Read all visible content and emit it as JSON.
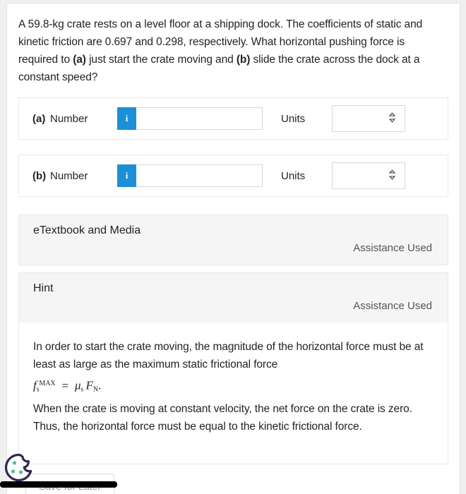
{
  "question": {
    "text_parts": [
      {
        "t": "A 59.8-kg crate rests on a level floor at a shipping dock. The coefficients of static and kinetic friction are 0.697 and 0.298, respectively. What horizontal pushing force is required to ",
        "b": false
      },
      {
        "t": "(a)",
        "b": true
      },
      {
        "t": " just start the crate moving and ",
        "b": false
      },
      {
        "t": "(b)",
        "b": true
      },
      {
        "t": " slide the crate across the dock at a constant speed?",
        "b": false
      }
    ],
    "full_text": "A 59.8-kg crate rests on a level floor at a shipping dock. The coefficients of static and kinetic friction are 0.697 and 0.298, respectively. What horizontal pushing force is required to (a) just start the crate moving and (b) slide the crate across the dock at a constant speed?",
    "mass": "59.8-kg",
    "mu_static": "0.697",
    "mu_kinetic": "0.298"
  },
  "answers": [
    {
      "part": "(a)",
      "number_label": "Number",
      "info_badge": "i",
      "number_value": "",
      "number_placeholder": "",
      "units_label": "Units",
      "units_value": "",
      "units_options": [
        ""
      ]
    },
    {
      "part": "(b)",
      "number_label": "Number",
      "info_badge": "i",
      "number_value": "",
      "number_placeholder": "",
      "units_label": "Units",
      "units_value": "",
      "units_options": [
        ""
      ]
    }
  ],
  "etextbook": {
    "title": "eTextbook and Media",
    "assistance": "Assistance Used"
  },
  "hint": {
    "title": "Hint",
    "assistance": "Assistance Used",
    "paragraph_1": "In order to start the crate moving, the magnitude of the horizontal force must be at least as large as the maximum static frictional force",
    "formula": {
      "f_symbol": "f",
      "f_sub": "s",
      "f_sup": "MAX",
      "equals": "=",
      "mu_symbol": "μ",
      "mu_sub": "s",
      "F_symbol": "F",
      "F_sub": "N",
      "period": ".",
      "plain": "f s MAX = μs FN."
    },
    "paragraph_2": "When the crate is moving at constant velocity, the net force on the crate is zero. Thus, the horizontal force must be equal to the kinetic frictional force."
  },
  "footer": {
    "save_label": "Save for Later"
  },
  "icons": {
    "cookie": "cookie-consent-icon",
    "chevron_updown": "⇕",
    "select_chevron": "⌃⌄"
  },
  "colors": {
    "info_badge_blue": "#1d8fd4",
    "panel_gray": "#f5f5f5",
    "border_gray": "#e8e8e8",
    "text_dark": "#232323",
    "text_muted": "#555555",
    "cookie_outline": "#2e2a4f",
    "cookie_dot": "#45c792",
    "scrollbar": "#000000"
  }
}
